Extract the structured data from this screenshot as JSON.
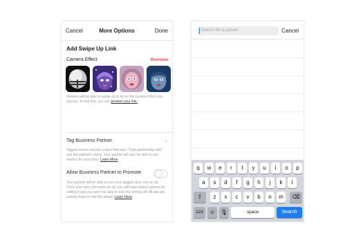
{
  "left": {
    "nav": {
      "cancel": "Cancel",
      "title": "More Options",
      "done": "Done"
    },
    "section_title": "Add Swipe Up Link",
    "camera_label": "Camera Effect",
    "remove_label": "Remove",
    "effects": [
      "helmet",
      "galaxy-face",
      "pink-face",
      "blue-face"
    ],
    "camera_desc": "Viewers will be able to swipe up to try on the camera effect you choose. To test this, you can",
    "camera_link": "preview your link.",
    "tag_label": "Tag Business Partner",
    "tag_desc": "Tagged stories include a label that says \"Paid partnership with\" and the partner's name. Your partner will also be able to see metrics for your story.",
    "tag_link": "Learn More",
    "allow_label": "Allow Business Partner to Promote",
    "allow_enabled": false,
    "allow_desc": "Your partner will be able to turn your tagged story into an ad. Once your story becomes an ad, you will have limited options for editing it and you won't be able to turn this setting off. All ads are publicly listed in the Ad Library.",
    "allow_link": "Learn More"
  },
  "right": {
    "search_placeholder": "Search for a partner",
    "cancel": "Cancel",
    "keyboard": {
      "row1": [
        "q",
        "w",
        "e",
        "r",
        "t",
        "y",
        "u",
        "i",
        "o",
        "p"
      ],
      "row2": [
        "a",
        "s",
        "d",
        "f",
        "g",
        "h",
        "j",
        "k",
        "l"
      ],
      "row3": [
        "z",
        "x",
        "c",
        "v",
        "b",
        "n",
        "m"
      ],
      "numbers": "123",
      "space": "space",
      "search": "Search"
    }
  },
  "colors": {
    "remove": "#e8485a",
    "search_key": "#1a7ff4",
    "keyboard_bg": "#d2d5db"
  }
}
